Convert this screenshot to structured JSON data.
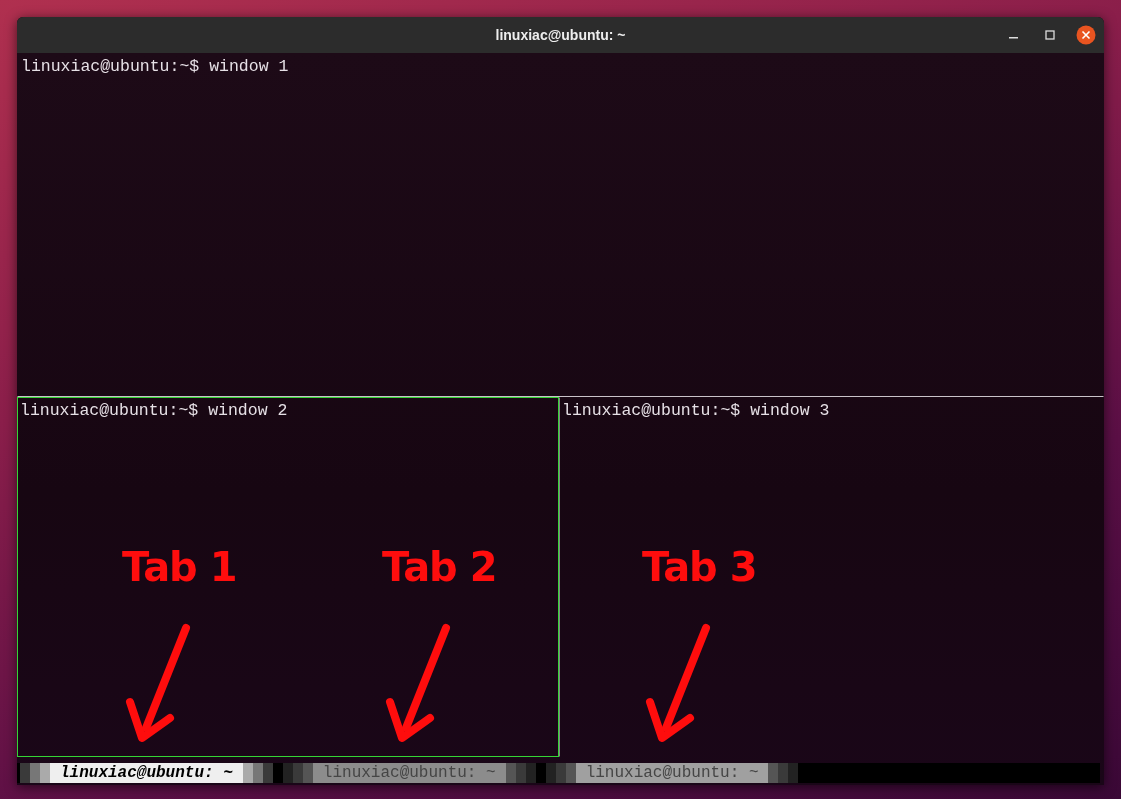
{
  "window": {
    "title": "linuxiac@ubuntu: ~"
  },
  "panes": [
    {
      "prompt": "linuxiac@ubuntu:~$ window 1",
      "active": false
    },
    {
      "prompt": "linuxiac@ubuntu:~$ window 2",
      "active": true
    },
    {
      "prompt": "linuxiac@ubuntu:~$ window 3",
      "active": false
    }
  ],
  "tabs": [
    {
      "label": "linuxiac@ubuntu: ~",
      "selected": true
    },
    {
      "label": "linuxiac@ubuntu: ~",
      "selected": false
    },
    {
      "label": "linuxiac@ubuntu: ~",
      "selected": false
    }
  ],
  "annotations": [
    {
      "text": "Tab 1"
    },
    {
      "text": "Tab 2"
    },
    {
      "text": "Tab 3"
    }
  ]
}
